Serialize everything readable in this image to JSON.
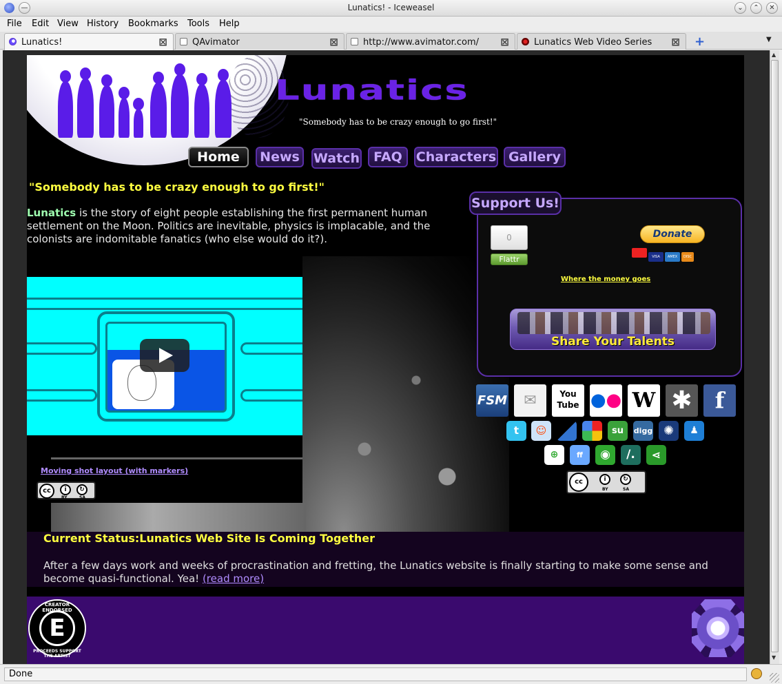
{
  "window": {
    "title": "Lunatics! - Iceweasel"
  },
  "menu": {
    "file": "File",
    "edit": "Edit",
    "view": "View",
    "history": "History",
    "bookmarks": "Bookmarks",
    "tools": "Tools",
    "help": "Help"
  },
  "tabs": [
    {
      "label": "Lunatics!"
    },
    {
      "label": "QAvimator"
    },
    {
      "label": "http://www.avimator.com/"
    },
    {
      "label": "Lunatics Web Video Series"
    }
  ],
  "site": {
    "logo": "Lunatics",
    "tagline": "\"Somebody has to be crazy enough to go first!\"",
    "nav": {
      "home": "Home",
      "news": "News",
      "watch": "Watch",
      "faq": "FAQ",
      "characters": "Characters",
      "gallery": "Gallery"
    },
    "quote": "\"Somebody has to be crazy enough to go first!\"",
    "intro_highlight": "Lunatics",
    "intro_text": " is the story of eight people establishing the first permanent human settlement on the Moon. Politics are inevitable, physics is implacable, and the colonists are indomitable fanatics (who else would do it?).",
    "video_link": "Moving shot layout (with markers)",
    "cc": {
      "symbol": "cc",
      "by": "BY",
      "sa": "SA"
    }
  },
  "support": {
    "title": "Support Us!",
    "flattr_count": "0",
    "flattr_label": "Flattr",
    "donate_label": "Donate",
    "cards": [
      "VISA",
      "AMEX",
      "DISC",
      "BANK"
    ],
    "money_link": "Where the money goes",
    "talents": "Share Your Talents"
  },
  "social": {
    "fsm": "FSM",
    "youtube": "You Tube",
    "wiki": "W",
    "facebook": "f",
    "digg": "digg",
    "ff": "ff"
  },
  "status_section": {
    "title": "Current Status:Lunatics Web Site Is Coming Together",
    "body": "After a few days work and weeks of procrastination and fretting, the Lunatics website is finally starting to make some sense and become quasi-functional. Yea! ",
    "read_more": "(read more)"
  },
  "footer": {
    "endorsed_top": "CREATOR ENDORSED",
    "endorsed_bottom": "PROCEEDS SUPPORT THE ARTIST",
    "endorsed_letter": "E"
  },
  "browser_status": "Done"
}
